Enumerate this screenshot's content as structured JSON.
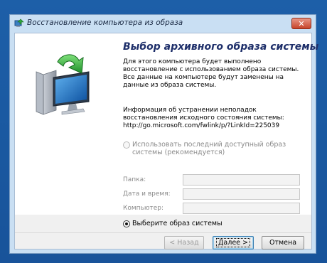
{
  "window": {
    "title": "Восстановление компьютера из образа",
    "close_label": "✕"
  },
  "page": {
    "heading": "Выбор архивного образа системы",
    "description": "Для этого компьютера будет выполнено восстановление с использованием образа системы. Все данные на компьютере будут заменены на данные из образа системы.",
    "help_text": "Информация об устранении неполадок восстановления исходного состояния системы:",
    "help_link": "http://go.microsoft.com/fwlink/p/?LinkId=225039"
  },
  "options": {
    "latest_image": {
      "label": "Использовать последний доступный образ системы (рекомендуется)",
      "selected": false,
      "enabled": false
    },
    "fields": [
      {
        "label": "Папка:",
        "value": ""
      },
      {
        "label": "Дата и время:",
        "value": ""
      },
      {
        "label": "Компьютер:",
        "value": ""
      }
    ],
    "choose_image": {
      "label": "Выберите образ системы",
      "selected": true
    }
  },
  "buttons": {
    "back": "< Назад",
    "next": "Далее >",
    "cancel": "Отмена"
  },
  "colors": {
    "desktop": "#1d5fa8",
    "heading": "#1e2f6a",
    "close_button": "#c7442a"
  },
  "icons": {
    "title": "restore-icon",
    "illustration": "computer-restore-arrow-icon"
  }
}
